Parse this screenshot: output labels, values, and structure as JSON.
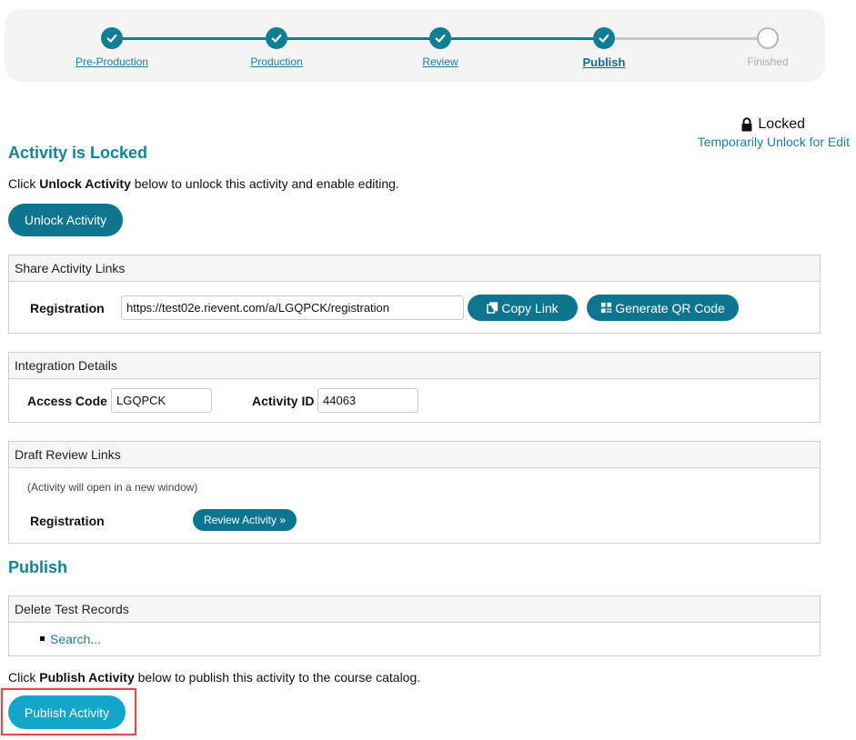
{
  "stepper": {
    "steps": [
      {
        "label": "Pre-Production",
        "state": "done"
      },
      {
        "label": "Production",
        "state": "done"
      },
      {
        "label": "Review",
        "state": "done"
      },
      {
        "label": "Publish",
        "state": "current"
      },
      {
        "label": "Finished",
        "state": "pending"
      }
    ],
    "accent_color": "#0f7f96"
  },
  "lock": {
    "status": "Locked",
    "unlock_link": "Temporarily Unlock for Edit"
  },
  "locked_section": {
    "title": "Activity is Locked",
    "instr_pre": "Click ",
    "instr_bold": "Unlock Activity",
    "instr_post": " below to unlock this activity and enable editing.",
    "button": "Unlock Activity"
  },
  "share_links": {
    "header": "Share Activity Links",
    "label": "Registration",
    "url": "https://test02e.rievent.com/a/LGQPCK/registration",
    "copy_button": "Copy Link",
    "qr_button": "Generate QR Code"
  },
  "integration": {
    "header": "Integration Details",
    "access_code_label": "Access Code",
    "access_code": "LGQPCK",
    "activity_id_label": "Activity ID",
    "activity_id": "44063"
  },
  "draft_review": {
    "header": "Draft Review Links",
    "note": "(Activity will open in a new window)",
    "label": "Registration",
    "button": "Review Activity »"
  },
  "publish_section": {
    "title": "Publish",
    "delete_header": "Delete Test Records",
    "search_link": "Search...",
    "instr_pre": "Click ",
    "instr_bold": "Publish Activity",
    "instr_post": " below to publish this activity to the course catalog.",
    "button": "Publish Activity",
    "highlight_color": "#e04a4a"
  }
}
